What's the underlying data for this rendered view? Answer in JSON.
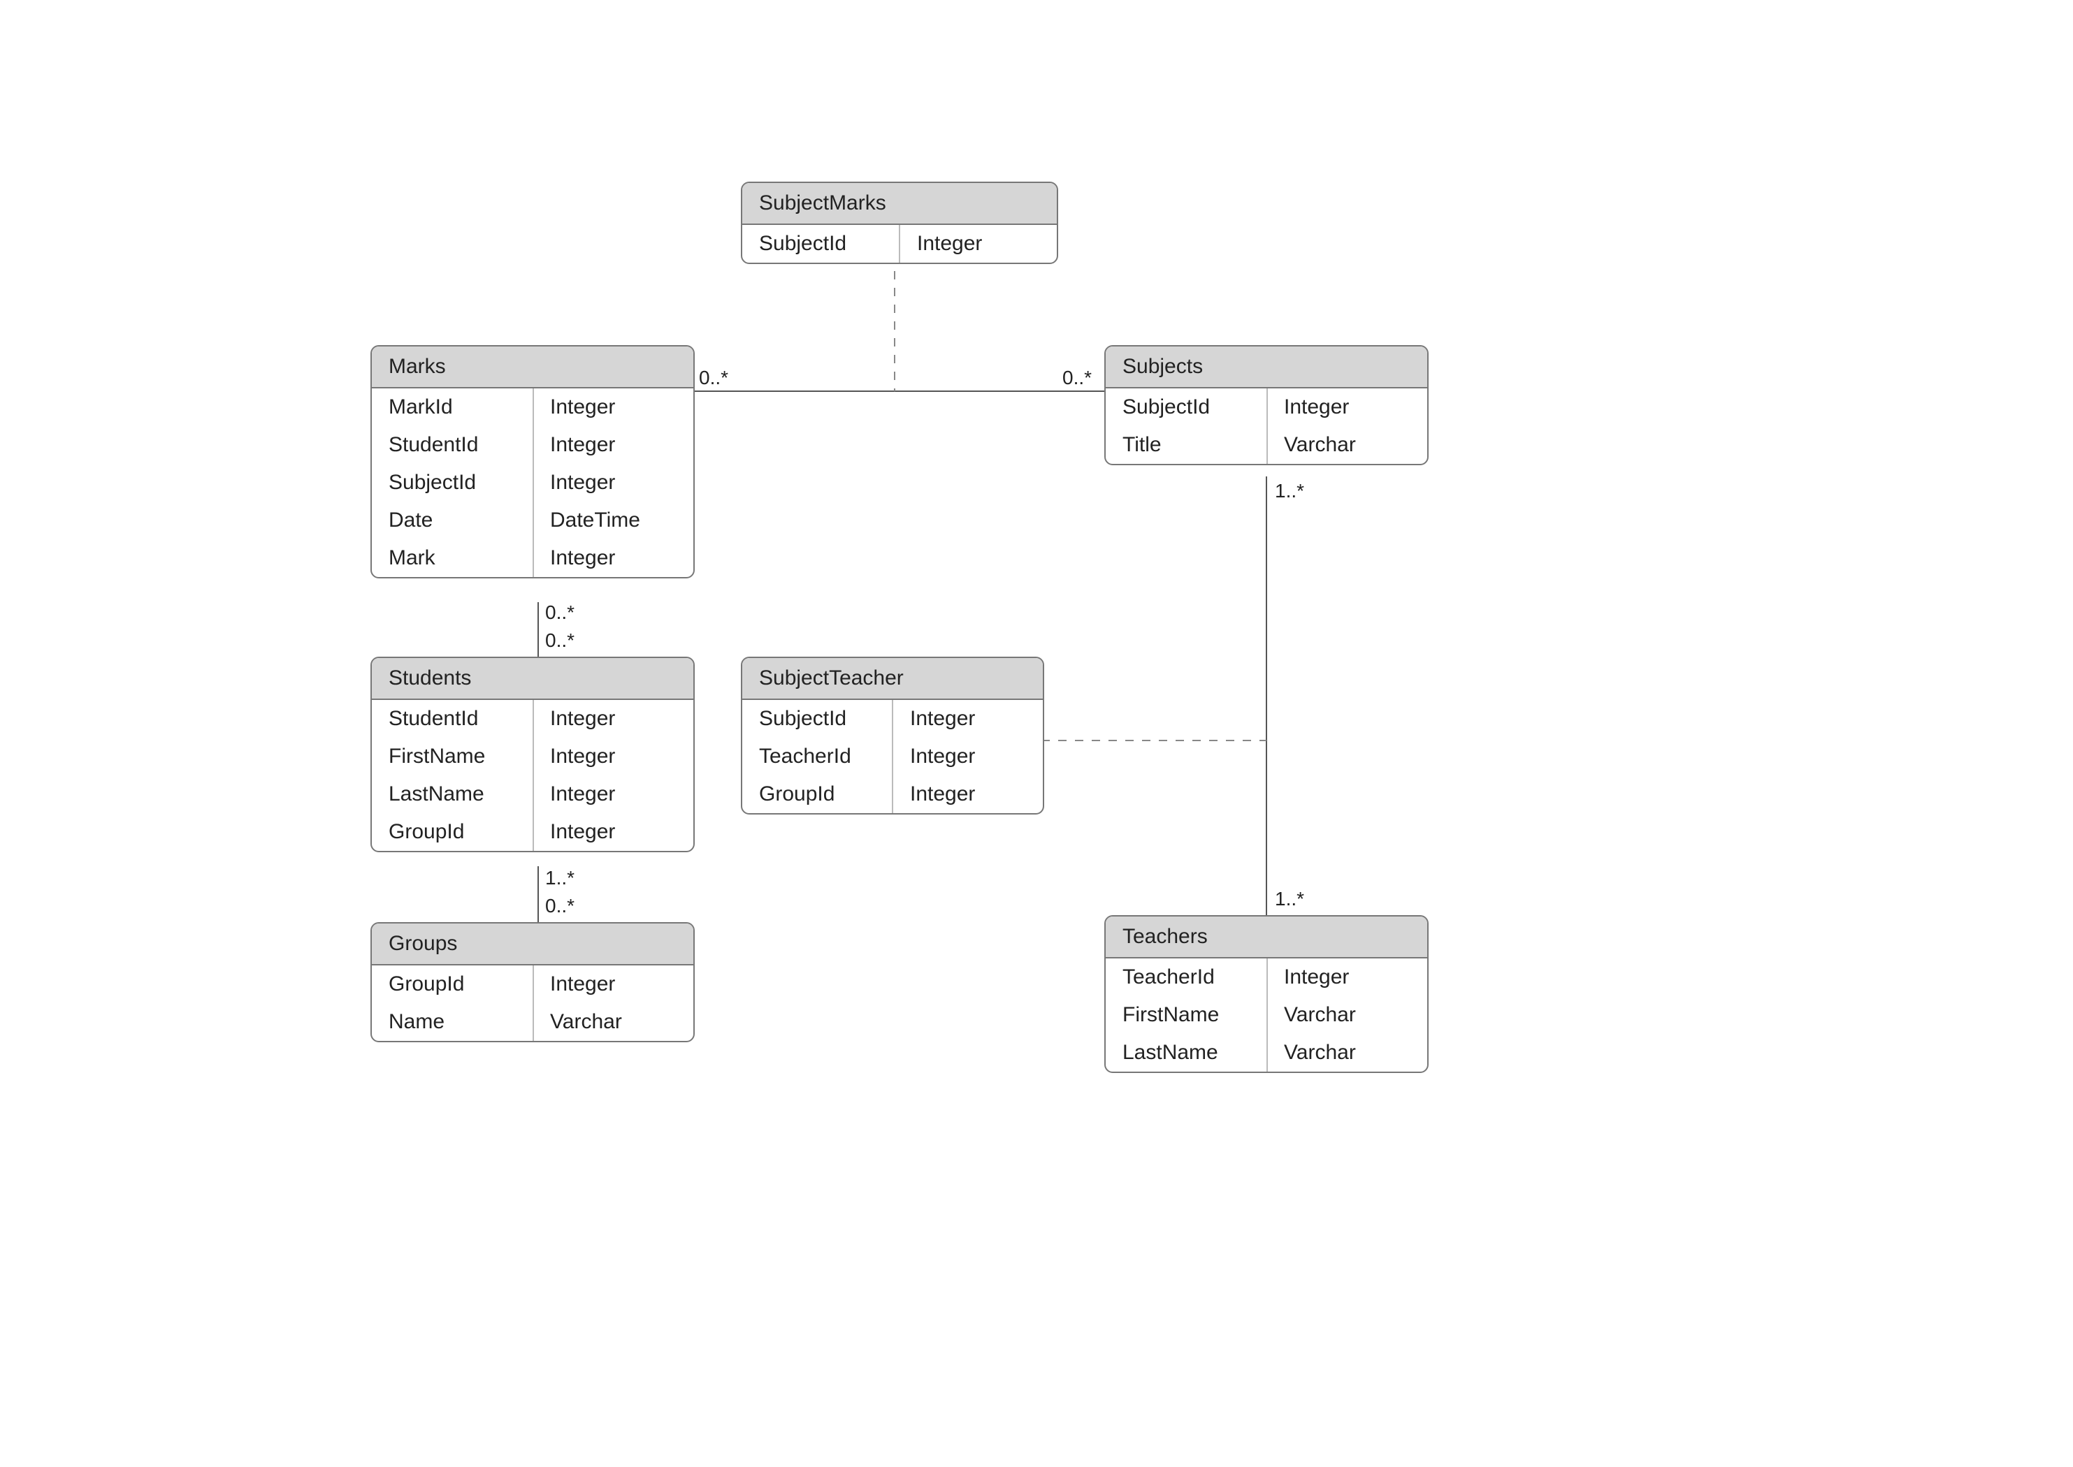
{
  "entities": {
    "subjectMarks": {
      "title": "SubjectMarks",
      "rows": [
        {
          "name": "SubjectId",
          "type": "Integer"
        }
      ]
    },
    "marks": {
      "title": "Marks",
      "rows": [
        {
          "name": "MarkId",
          "type": "Integer"
        },
        {
          "name": "StudentId",
          "type": "Integer"
        },
        {
          "name": "SubjectId",
          "type": "Integer"
        },
        {
          "name": "Date",
          "type": "DateTime"
        },
        {
          "name": "Mark",
          "type": "Integer"
        }
      ]
    },
    "subjects": {
      "title": "Subjects",
      "rows": [
        {
          "name": "SubjectId",
          "type": "Integer"
        },
        {
          "name": "Title",
          "type": "Varchar"
        }
      ]
    },
    "students": {
      "title": "Students",
      "rows": [
        {
          "name": "StudentId",
          "type": "Integer"
        },
        {
          "name": "FirstName",
          "type": "Integer"
        },
        {
          "name": "LastName",
          "type": "Integer"
        },
        {
          "name": "GroupId",
          "type": "Integer"
        }
      ]
    },
    "subjectTeacher": {
      "title": "SubjectTeacher",
      "rows": [
        {
          "name": "SubjectId",
          "type": "Integer"
        },
        {
          "name": "TeacherId",
          "type": "Integer"
        },
        {
          "name": "GroupId",
          "type": "Integer"
        }
      ]
    },
    "groups": {
      "title": "Groups",
      "rows": [
        {
          "name": "GroupId",
          "type": "Integer"
        },
        {
          "name": "Name",
          "type": "Varchar"
        }
      ]
    },
    "teachers": {
      "title": "Teachers",
      "rows": [
        {
          "name": "TeacherId",
          "type": "Integer"
        },
        {
          "name": "FirstName",
          "type": "Varchar"
        },
        {
          "name": "LastName",
          "type": "Varchar"
        }
      ]
    }
  },
  "labels": {
    "marksSubjectsLeft": "0..*",
    "marksSubjectsRight": "0..*",
    "marksStudentsTop": "0..*",
    "marksStudentsBottom": "0..*",
    "studentsGroupsTop": "1..*",
    "studentsGroupsBottom": "0..*",
    "subjectsTeachersTop": "1..*",
    "subjectsTeachersBottom": "1..*"
  }
}
